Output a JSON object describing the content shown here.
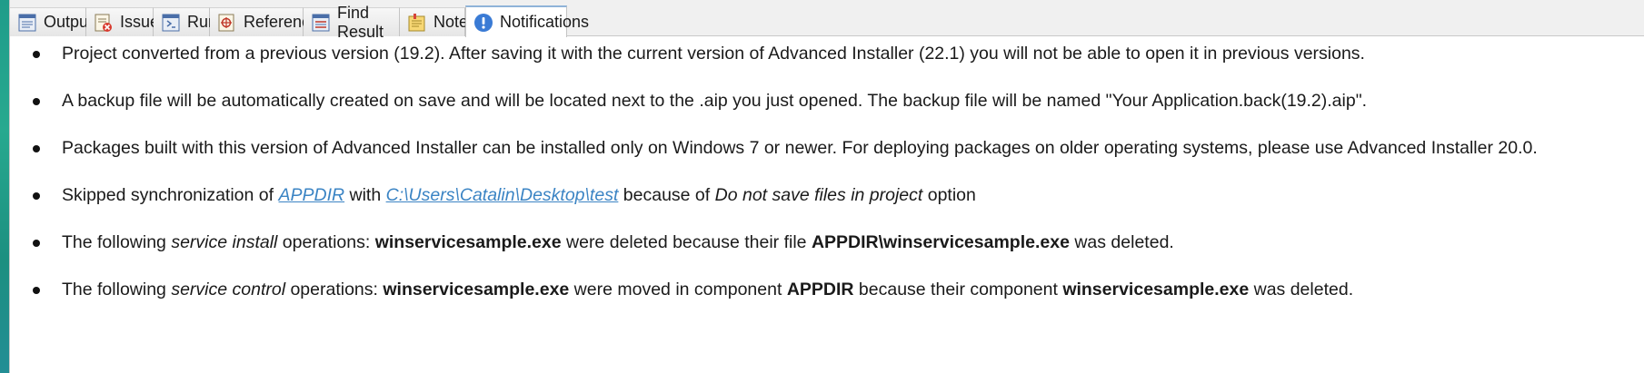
{
  "tabs": [
    {
      "label": "Output",
      "icon": "output-icon"
    },
    {
      "label": "Issues",
      "icon": "issues-icon"
    },
    {
      "label": "Run",
      "icon": "run-icon"
    },
    {
      "label": "References",
      "icon": "references-icon"
    },
    {
      "label": "Find Result",
      "icon": "find-result-icon"
    },
    {
      "label": "Notes",
      "icon": "notes-icon"
    },
    {
      "label": "Notifications",
      "icon": "notifications-icon",
      "active": true
    }
  ],
  "notifications": [
    {
      "text": "Project converted from a previous version (19.2). After saving it with the current version of Advanced Installer (22.1) you will not be able to open it in previous versions."
    },
    {
      "text": "A backup file will be automatically created on save and will be located next to the .aip you just opened. The backup file will be named \"Your Application.back(19.2).aip\"."
    },
    {
      "text": "Packages built with this version of Advanced Installer can be installed only on Windows 7 or newer. For deploying packages on older operating systems, please use Advanced Installer 20.0."
    },
    {
      "prefix": "Skipped synchronization of ",
      "link1": "APPDIR",
      "mid1": " with ",
      "link2": "C:\\Users\\Catalin\\Desktop\\test",
      "mid2": " because of ",
      "italic": "Do not save files in project",
      "suffix": " option"
    },
    {
      "prefix": "The following ",
      "italic": "service install",
      "mid1": " operations: ",
      "bold1": "winservicesample.exe",
      "mid2": " were deleted because their file ",
      "bold2": "APPDIR\\winservicesample.exe",
      "suffix": " was deleted."
    },
    {
      "prefix": "The following ",
      "italic": "service control",
      "mid1": " operations: ",
      "bold1": "winservicesample.exe",
      "mid2": " were moved in component ",
      "bold2": "APPDIR",
      "mid3": " because their component ",
      "bold3": "winservicesample.exe",
      "suffix": " was deleted."
    }
  ],
  "colors": {
    "link": "#3b84c4",
    "tab_bar": "#f0f0f0",
    "active_tab_border": "#8fb3d9",
    "info_icon": "#3a7bd5"
  }
}
